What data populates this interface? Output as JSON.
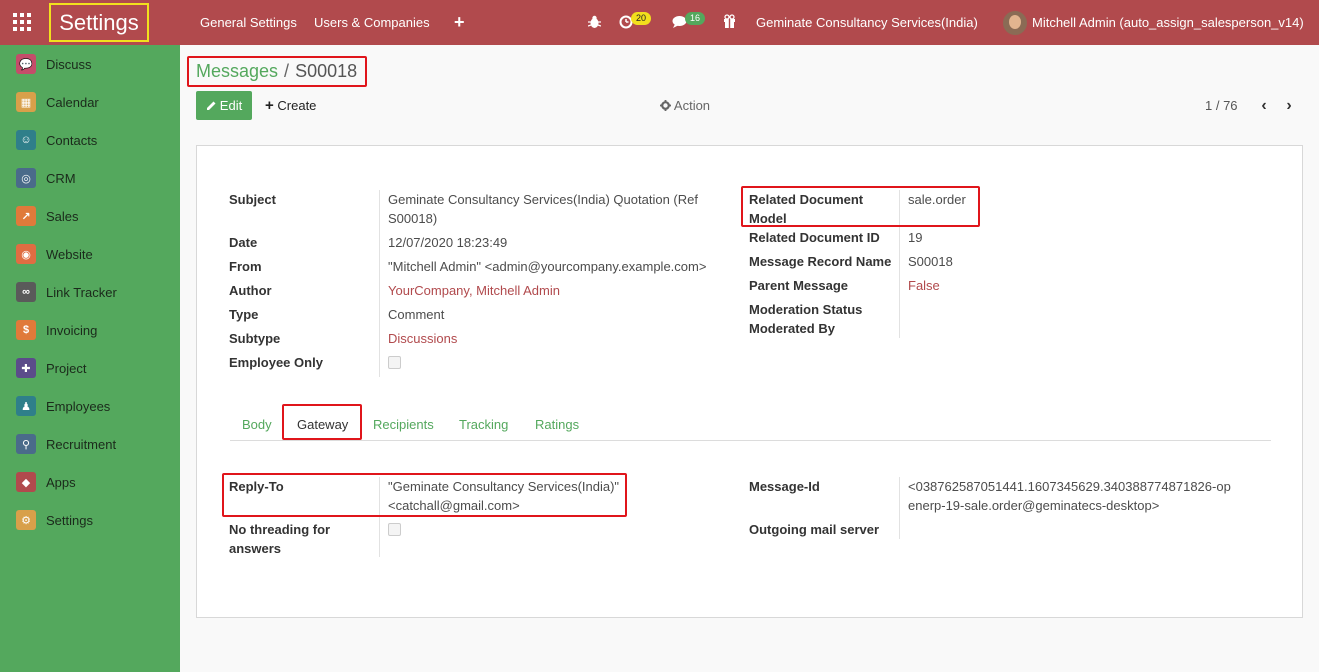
{
  "navbar": {
    "brand": "Settings",
    "menu": [
      "General Settings",
      "Users & Companies",
      "+"
    ],
    "activity_count": "20",
    "messages_count": "16",
    "company": "Geminate Consultancy Services(India)",
    "user": "Mitchell Admin (auto_assign_salesperson_v14)",
    "icons": [
      "apps-grid-icon",
      "bug-icon",
      "clock-icon",
      "chat-icon",
      "gift-icon"
    ],
    "colors": {
      "bar": "#b14a4d",
      "activity_badge": "#f2e01d",
      "messages_badge": "#54a85d"
    }
  },
  "sidebar": {
    "color": "#54a85d",
    "items": [
      {
        "label": "Discuss",
        "icon": "discuss-icon",
        "color": "#c44d6a"
      },
      {
        "label": "Calendar",
        "icon": "calendar-icon",
        "color": "#d8a04a"
      },
      {
        "label": "Contacts",
        "icon": "contacts-icon",
        "color": "#2f7f8a"
      },
      {
        "label": "CRM",
        "icon": "crm-icon",
        "color": "#4a6b8a"
      },
      {
        "label": "Sales",
        "icon": "sales-icon",
        "color": "#e07a3a"
      },
      {
        "label": "Website",
        "icon": "website-icon",
        "color": "#e06d42"
      },
      {
        "label": "Link Tracker",
        "icon": "link-icon",
        "color": "#5a5a5a"
      },
      {
        "label": "Invoicing",
        "icon": "invoicing-icon",
        "color": "#e07a3a"
      },
      {
        "label": "Project",
        "icon": "project-icon",
        "color": "#5b4c8a"
      },
      {
        "label": "Employees",
        "icon": "employees-icon",
        "color": "#2f7f8a"
      },
      {
        "label": "Recruitment",
        "icon": "recruitment-icon",
        "color": "#4a6b8a"
      },
      {
        "label": "Apps",
        "icon": "apps-icon",
        "color": "#b14a4d"
      },
      {
        "label": "Settings",
        "icon": "settings-icon",
        "color": "#d8a04a"
      }
    ]
  },
  "breadcrumb": {
    "parent": "Messages",
    "separator": "/",
    "current": "S00018"
  },
  "toolbar": {
    "edit": "Edit",
    "create": "Create",
    "action": "Action",
    "pager": "1 / 76"
  },
  "form": {
    "left": [
      {
        "label": "Subject",
        "value": "Geminate Consultancy Services(India) Quotation (Ref S00018)"
      },
      {
        "label": "Date",
        "value": "12/07/2020 18:23:49"
      },
      {
        "label": "From",
        "value": "\"Mitchell Admin\" <admin@yourcompany.example.com>"
      },
      {
        "label": "Author",
        "value": "YourCompany, Mitchell Admin"
      },
      {
        "label": "Type",
        "value": "Comment"
      },
      {
        "label": "Subtype",
        "value": "Discussions"
      },
      {
        "label": "Employee Only",
        "value": ""
      }
    ],
    "right": [
      {
        "label": "Related Document Model",
        "value": "sale.order"
      },
      {
        "label": "Related Document ID",
        "value": "19"
      },
      {
        "label": "Message Record Name",
        "value": "S00018"
      },
      {
        "label": "Parent Message",
        "value": "False"
      },
      {
        "label": "Moderation Status",
        "value": ""
      },
      {
        "label": "Moderated By",
        "value": ""
      }
    ]
  },
  "tabs": [
    "Body",
    "Gateway",
    "Recipients",
    "Tracking",
    "Ratings"
  ],
  "gateway": {
    "reply_to_label": "Reply-To",
    "reply_to_value": "\"Geminate Consultancy Services(India)\" <catchall@gmail.com>",
    "no_threading_label": "No threading for answers",
    "message_id_label": "Message-Id",
    "message_id_value": "<038762587051441.1607345629.340388774871826-openerp-19-sale.order@geminatecs-desktop>",
    "outgoing_label": "Outgoing mail server",
    "outgoing_value": ""
  }
}
